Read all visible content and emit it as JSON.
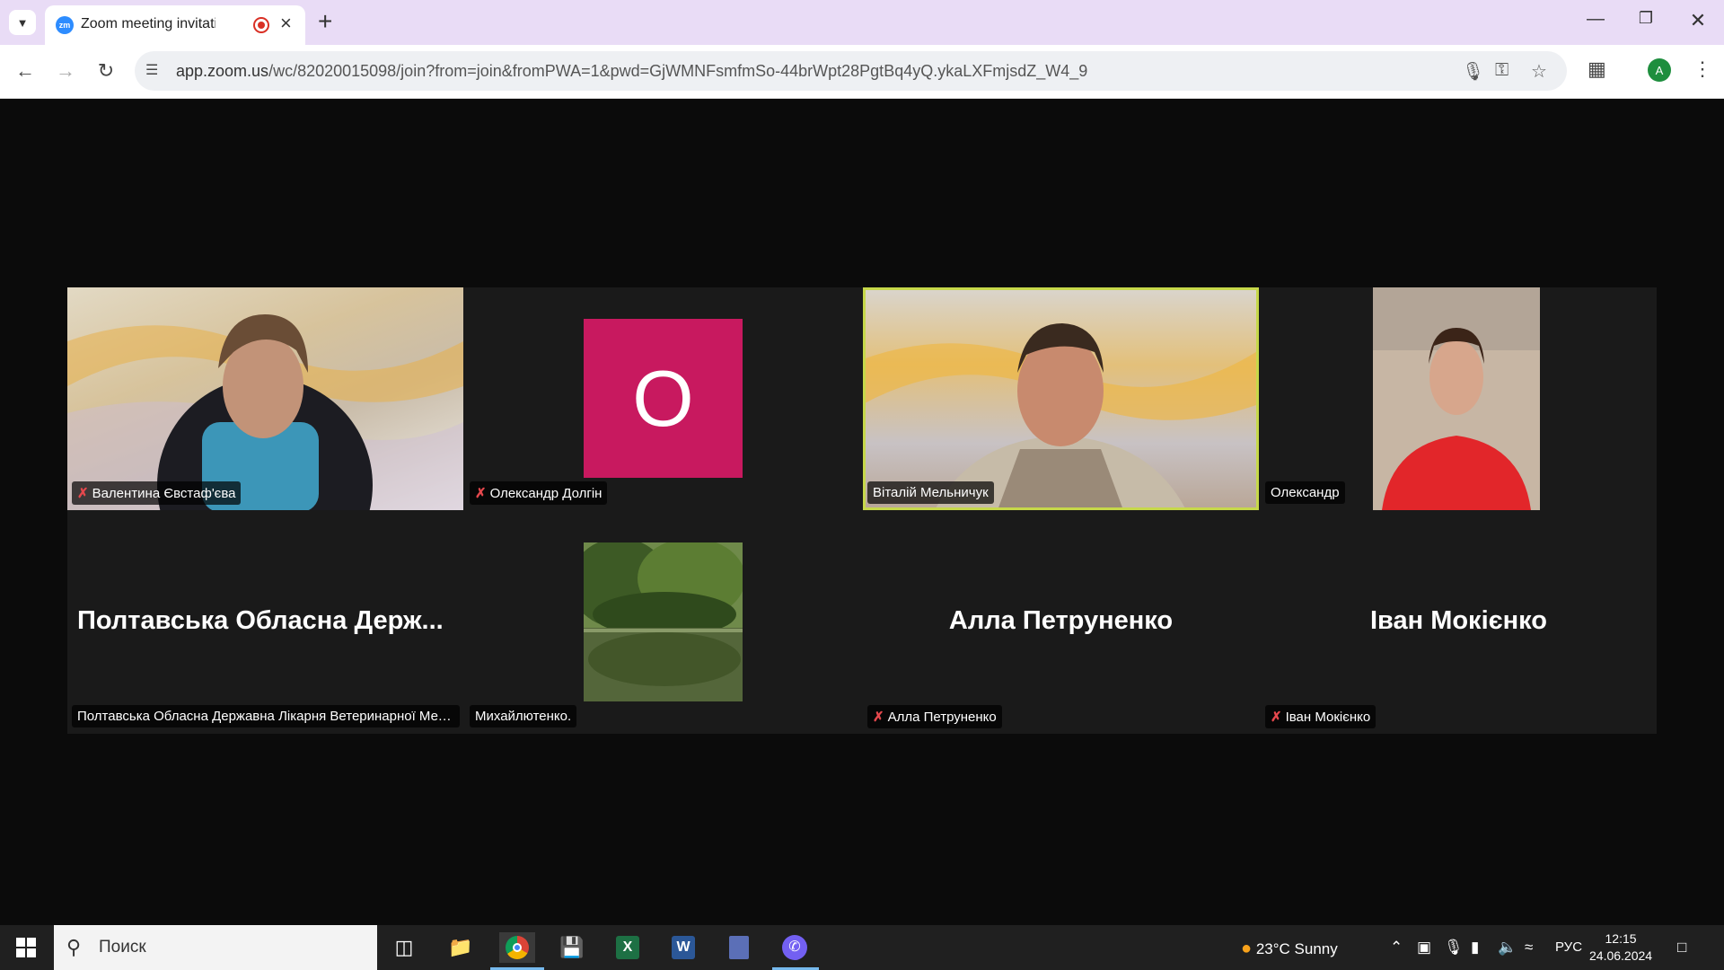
{
  "browser": {
    "tab_title": "Zoom meeting invitation - Zoom",
    "tab_favicon": "zm",
    "url_host": "app.zoom.us",
    "url_path": "/wc/82020015098/join?from=join&fromPWA=1&pwd=GjWMNFsmfmSo-44brWpt28PgtBq4yQ.ykaLXFmjsdZ_W4_9",
    "profile_initial": "A"
  },
  "participants": {
    "p1": {
      "name": "Валентина Євстаф'єва",
      "muted": true
    },
    "p2": {
      "name": "Олександр Долгін",
      "initial": "О",
      "muted": true
    },
    "p3": {
      "name": "Віталій Мельничук",
      "muted": false,
      "active_speaker": true
    },
    "p4": {
      "name": "Олександр",
      "muted": false
    },
    "p5": {
      "name": "Полтавська Обласна Державна Лікарня Ветеринарної Мед...",
      "big_name": "Полтавська Обласна Держ...",
      "muted": false
    },
    "p6": {
      "name": "Михайлютенко.",
      "muted": false
    },
    "p7": {
      "name": "Алла Петруненко",
      "big_name": "Алла Петруненко",
      "muted": true
    },
    "p8": {
      "name": "Іван Мокієнко",
      "big_name": "Іван Мокієнко",
      "muted": true
    }
  },
  "taskbar": {
    "search_placeholder": "Поиск",
    "weather": "23°C  Sunny",
    "language": "РУС",
    "time": "12:15",
    "date": "24.06.2024"
  },
  "colors": {
    "tabbar": "#e9dcf6",
    "active_speaker_border": "#c6d84a",
    "avatar_bg": "#c8195f",
    "mute": "#e5484d"
  }
}
